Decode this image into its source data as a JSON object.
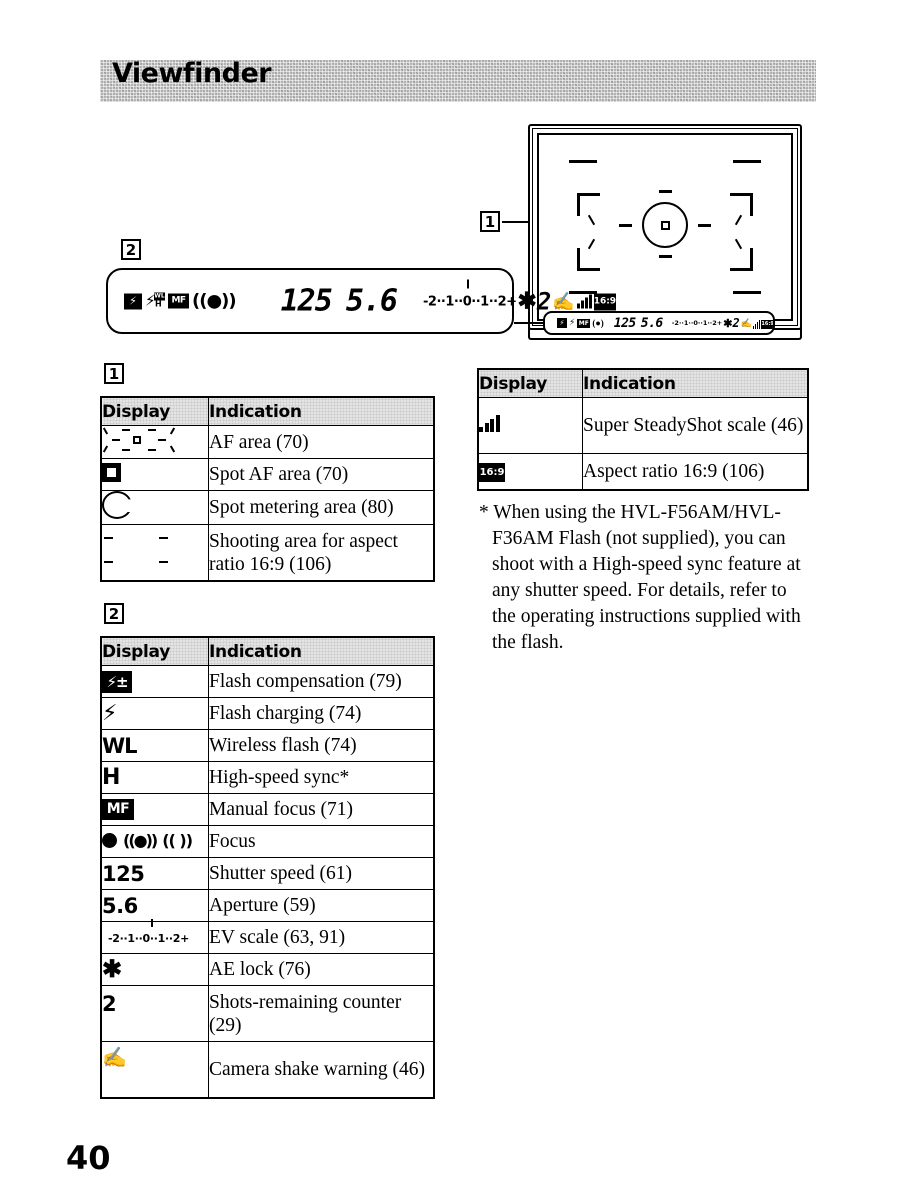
{
  "header": {
    "title": "Viewfinder"
  },
  "page": {
    "number": "40"
  },
  "callouts": {
    "one": "1",
    "two": "2"
  },
  "viewfinder": {
    "name": "viewfinder-frame-diagram",
    "elements": [
      "aspect-ratio-16-9-marks",
      "af-area-corner-brackets",
      "spot-metering-circle",
      "spot-af-area-square"
    ]
  },
  "lcd": {
    "icons_left": [
      "flash-compensation-icon",
      "flash-charging-wl-h-icon",
      "manual-focus-icon",
      "focus-indicator-icon"
    ],
    "shutter_speed": "125",
    "aperture": "5.6",
    "ev_scale": "-2··1··0··1··2+",
    "ae_lock": "✱",
    "shots_remaining": "2",
    "icons_right": [
      "camera-shake-warning-icon",
      "super-steadyshot-scale-icon",
      "aspect-ratio-16-9-icon"
    ]
  },
  "table_one": {
    "label": "1",
    "headers": [
      "Display",
      "Indication"
    ],
    "rows": [
      {
        "display_icon": "af-area-icon",
        "indication": "AF area (70)"
      },
      {
        "display_icon": "spot-af-area-icon",
        "indication": "Spot AF area (70)"
      },
      {
        "display_icon": "spot-metering-area-icon",
        "indication": "Spot metering area (80)"
      },
      {
        "display_icon": "shooting-area-16-9-icon",
        "indication": "Shooting area for aspect ratio 16:9 (106)"
      }
    ]
  },
  "table_two": {
    "label": "2",
    "headers": [
      "Display",
      "Indication"
    ],
    "rows": [
      {
        "display_icon": "flash-compensation-icon",
        "display_text": "",
        "indication": "Flash compensation (79)"
      },
      {
        "display_icon": "flash-charging-icon",
        "display_text": "",
        "indication": "Flash charging (74)"
      },
      {
        "display_icon": "wireless-flash-icon",
        "display_text": "WL",
        "indication": "Wireless flash (74)"
      },
      {
        "display_icon": "high-speed-sync-icon",
        "display_text": "H",
        "indication": "High-speed sync*"
      },
      {
        "display_icon": "manual-focus-icon",
        "display_text": "MF",
        "indication": "Manual focus (71)"
      },
      {
        "display_icon": "focus-indicator-icon",
        "display_text": "",
        "indication": "Focus"
      },
      {
        "display_icon": "shutter-speed-value",
        "display_text": "125",
        "indication": "Shutter speed (61)"
      },
      {
        "display_icon": "aperture-value",
        "display_text": "5.6",
        "indication": "Aperture (59)"
      },
      {
        "display_icon": "ev-scale-icon",
        "display_text": "-2··1··0··1··2+",
        "indication": "EV scale (63, 91)"
      },
      {
        "display_icon": "ae-lock-icon",
        "display_text": "✱",
        "indication": "AE lock (76)"
      },
      {
        "display_icon": "shots-remaining-value",
        "display_text": "2",
        "indication": "Shots-remaining counter (29)"
      },
      {
        "display_icon": "camera-shake-warning-icon",
        "display_text": "",
        "indication": "Camera shake warning (46)"
      }
    ]
  },
  "table_three": {
    "headers": [
      "Display",
      "Indication"
    ],
    "rows": [
      {
        "display_icon": "super-steadyshot-scale-icon",
        "indication": "Super SteadyShot scale (46)"
      },
      {
        "display_icon": "aspect-ratio-16-9-icon",
        "indication": "Aspect ratio 16:9 (106)"
      }
    ]
  },
  "footnote": {
    "text": "* When using the HVL-F56AM/HVL-F36AM Flash (not supplied), you can shoot with a High-speed sync feature at any shutter speed. For details, refer to the operating instructions supplied with the flash."
  }
}
